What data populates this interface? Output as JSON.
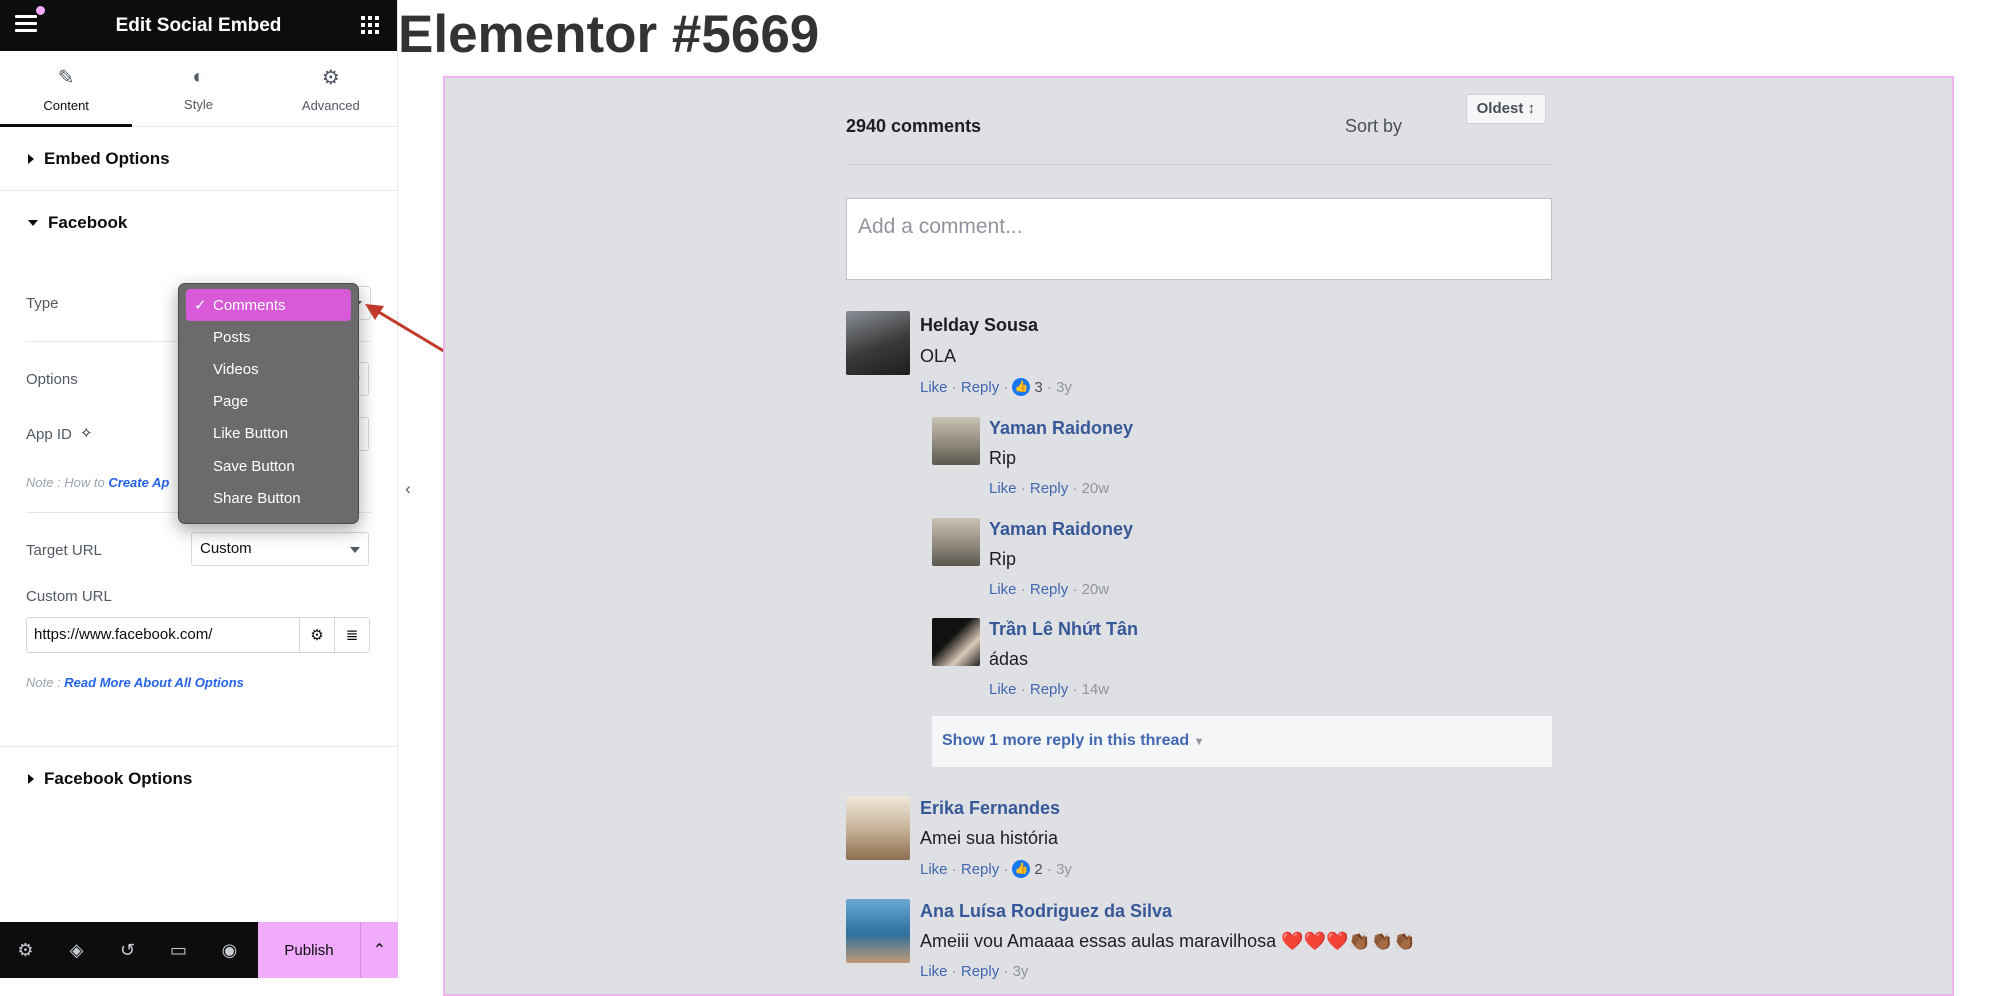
{
  "panel": {
    "title": "Edit Social Embed",
    "tabs": [
      {
        "label": "Content",
        "icon": "pencil-icon",
        "active": true
      },
      {
        "label": "Style",
        "icon": "contrast-icon",
        "active": false
      },
      {
        "label": "Advanced",
        "icon": "gear-icon",
        "active": false
      }
    ],
    "sections": {
      "embed_options": "Embed Options",
      "facebook": "Facebook",
      "facebook_options": "Facebook Options"
    },
    "controls": {
      "type_label": "Type",
      "options_label": "Options",
      "app_id_label": "App ID",
      "note_prefix": "Note : How to ",
      "note_link": "Create Ap",
      "target_url_label": "Target URL",
      "target_url_value": "Custom",
      "custom_url_label": "Custom URL",
      "custom_url_value": "https://www.facebook.com/",
      "note2_prefix": "Note : ",
      "note2_link": "Read More About All Options"
    },
    "type_dropdown": {
      "selected": "Comments",
      "options": [
        "Comments",
        "Posts",
        "Videos",
        "Page",
        "Like Button",
        "Save Button",
        "Share Button"
      ]
    },
    "footer": {
      "publish_label": "Publish"
    }
  },
  "preview": {
    "page_title": "Elementor #5669",
    "fb": {
      "comment_count": "2940 comments",
      "sort_label": "Sort by",
      "sort_value": "Oldest ↕",
      "compose_placeholder": "Add a comment...",
      "like_label": "Like",
      "reply_label": "Reply",
      "dot": "·",
      "show_more": "Show 1 more reply in this thread",
      "comments": [
        {
          "name": "Helday Sousa",
          "text": "OLA",
          "likes": "3",
          "time": "3y"
        },
        {
          "name": "Yaman Raidoney",
          "text": "Rip",
          "time": "20w"
        },
        {
          "name": "Yaman Raidoney",
          "text": "Rip",
          "time": "20w"
        },
        {
          "name": "Trần Lê Nhứt Tân",
          "text": "ádas",
          "time": "14w"
        },
        {
          "name": "Erika Fernandes",
          "text": "Amei sua história",
          "likes": "2",
          "time": "3y"
        },
        {
          "name": "Ana Luísa Rodriguez da Silva",
          "text": "Ameiii vou Amaaaa essas aulas maravilhosa ❤️❤️❤️👏🏾👏🏾👏🏾",
          "time": "3y"
        }
      ]
    }
  },
  "colors": {
    "accent": "#f0abfc",
    "dropdown_selected": "#d85ad8",
    "fb_link": "#4267b2",
    "embed_bg": "#dfe0e4"
  }
}
